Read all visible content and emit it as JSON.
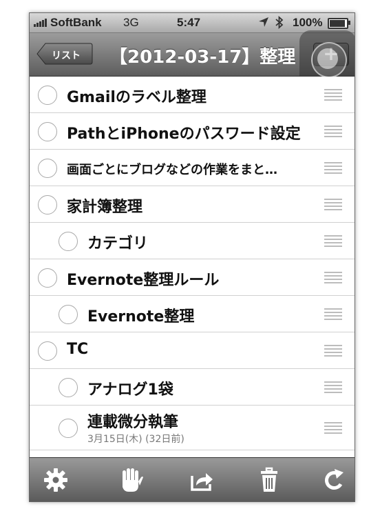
{
  "status_bar": {
    "carrier": "SoftBank",
    "network": "3G",
    "time": "5:47",
    "battery_percent": "100%",
    "battery_level": 1.0,
    "icons": [
      "signal-bars-icon",
      "location-arrow-icon",
      "bluetooth-icon",
      "battery-icon"
    ]
  },
  "nav": {
    "back_label": "リスト",
    "title": "【2012-03-17】整理",
    "add_label": "+"
  },
  "tasks": [
    {
      "label": "Gmailのラベル整理",
      "indent": 0
    },
    {
      "label": "PathとiPhoneのパスワード設定",
      "indent": 0
    },
    {
      "label": "画面ごとにブログなどの作業をまと…",
      "indent": 0
    },
    {
      "label": "家計簿整理",
      "indent": 0
    },
    {
      "label": "カテゴリ",
      "indent": 1
    },
    {
      "label": "Evernote整理ルール",
      "indent": 0
    },
    {
      "label": "Evernote整理",
      "indent": 1
    },
    {
      "label": "TC",
      "indent": 0
    },
    {
      "label": "アナログ1袋",
      "indent": 1
    },
    {
      "label": "連載微分執筆",
      "indent": 1,
      "date": "3月15日(木) (32日前)"
    }
  ],
  "toolbar": {
    "icons": [
      "gear-icon",
      "hand-icon",
      "share-icon",
      "trash-icon",
      "refresh-icon"
    ]
  },
  "colors": {
    "bar_light": "#9c9c9c",
    "bar_dark": "#5c5c5c",
    "separator": "#d0d0d0",
    "text": "#111111",
    "subtext": "#777777"
  }
}
